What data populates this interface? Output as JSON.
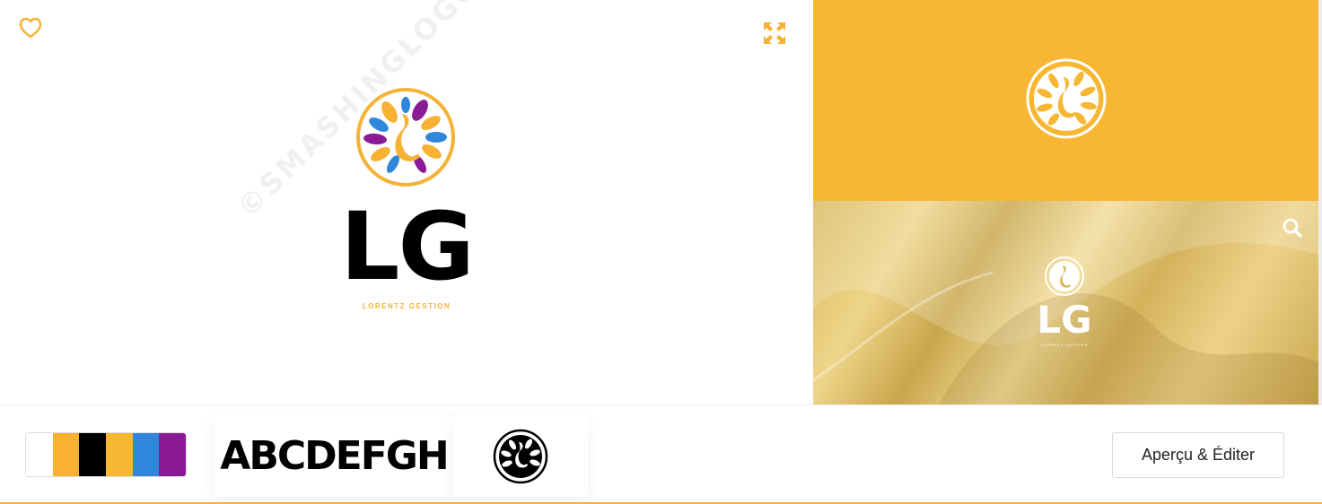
{
  "preview": {
    "watermark": "©SMASHINGLOGO",
    "logo": {
      "initials": "LG",
      "tagline": "LORENTZ GESTION"
    },
    "icons": {
      "favorite": "heart-icon",
      "expand": "expand-icon",
      "zoom": "search-icon"
    }
  },
  "mockups": {
    "texture": {
      "initials": "LG",
      "tagline": "LORENTZ GESTION"
    }
  },
  "palette": {
    "colors": [
      "#ffffff",
      "#f8b133",
      "#000000",
      "#f8b733",
      "#2f86db",
      "#8a1a96"
    ]
  },
  "font_sample": "ABCDEFGH",
  "actions": {
    "preview_edit_label": "Aperçu & Éditer"
  },
  "theme": {
    "accent": "#f5b335",
    "mockup_background": "#f8b733"
  }
}
